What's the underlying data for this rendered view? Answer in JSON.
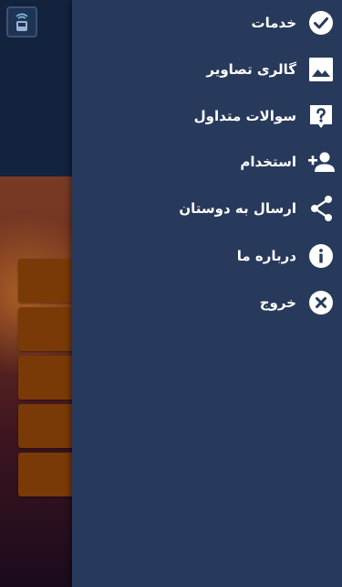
{
  "drawer": {
    "items": [
      {
        "label": "خدمات",
        "icon": "check-circle-icon"
      },
      {
        "label": "گالری تصاویر",
        "icon": "image-icon"
      },
      {
        "label": "سوالات متداول",
        "icon": "help-icon"
      },
      {
        "label": "استخدام",
        "icon": "add-person-icon"
      },
      {
        "label": "ارسال به دوستان",
        "icon": "share-icon"
      },
      {
        "label": "درباره ما",
        "icon": "info-icon"
      },
      {
        "label": "خروج",
        "icon": "close-circle-icon"
      }
    ]
  },
  "colors": {
    "drawer_bg": "#283a5b",
    "topbar_bg": "#13233d",
    "tile": "#7a3a08",
    "text": "#ffffff"
  }
}
